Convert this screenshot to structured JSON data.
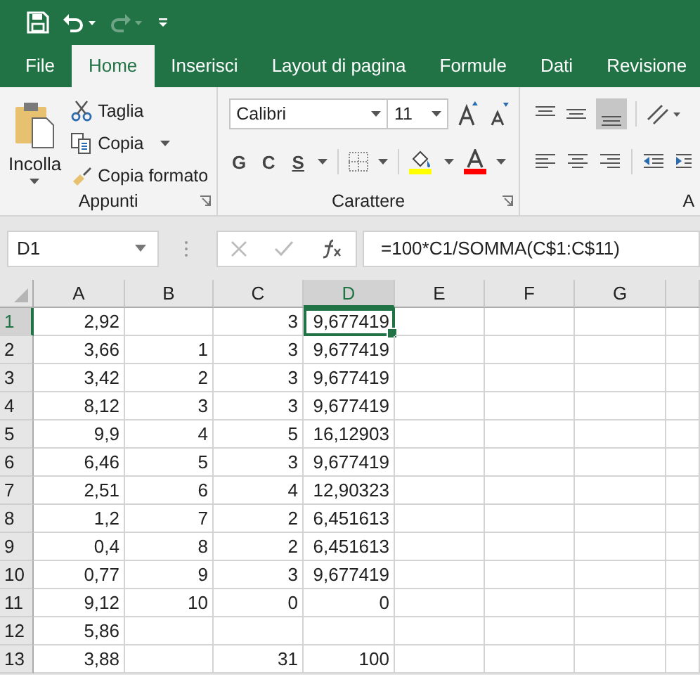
{
  "quick_access": {
    "redo_disabled": true
  },
  "tabs": [
    {
      "label": "File",
      "selected": false
    },
    {
      "label": "Home",
      "selected": true
    },
    {
      "label": "Inserisci",
      "selected": false
    },
    {
      "label": "Layout di pagina",
      "selected": false
    },
    {
      "label": "Formule",
      "selected": false
    },
    {
      "label": "Dati",
      "selected": false
    },
    {
      "label": "Revisione",
      "selected": false
    }
  ],
  "ribbon": {
    "clipboard": {
      "paste": "Incolla",
      "cut": "Taglia",
      "copy": "Copia",
      "format_painter": "Copia formato",
      "label": "Appunti"
    },
    "font": {
      "font_name": "Calibri",
      "font_size": "11",
      "bold": "G",
      "italic": "C",
      "underline": "S",
      "label": "Carattere"
    },
    "alignment": {
      "label": "A"
    }
  },
  "formula_bar": {
    "name_box": "D1",
    "formula": "=100*C1/SOMMA(C$1:C$11)"
  },
  "sheet": {
    "columns": [
      {
        "label": "A",
        "selected": false
      },
      {
        "label": "B",
        "selected": false
      },
      {
        "label": "C",
        "selected": false
      },
      {
        "label": "D",
        "selected": true
      },
      {
        "label": "E",
        "selected": false
      },
      {
        "label": "F",
        "selected": false
      },
      {
        "label": "G",
        "selected": false
      }
    ],
    "rows": [
      {
        "label": "1",
        "selected": true,
        "cells": [
          "2,92",
          null,
          "3",
          "9,677419"
        ]
      },
      {
        "label": "2",
        "selected": false,
        "cells": [
          "3,66",
          "1",
          "3",
          "9,677419"
        ]
      },
      {
        "label": "3",
        "selected": false,
        "cells": [
          "3,42",
          "2",
          "3",
          "9,677419"
        ]
      },
      {
        "label": "4",
        "selected": false,
        "cells": [
          "8,12",
          "3",
          "3",
          "9,677419"
        ]
      },
      {
        "label": "5",
        "selected": false,
        "cells": [
          "9,9",
          "4",
          "5",
          "16,12903"
        ]
      },
      {
        "label": "6",
        "selected": false,
        "cells": [
          "6,46",
          "5",
          "3",
          "9,677419"
        ]
      },
      {
        "label": "7",
        "selected": false,
        "cells": [
          "2,51",
          "6",
          "4",
          "12,90323"
        ]
      },
      {
        "label": "8",
        "selected": false,
        "cells": [
          "1,2",
          "7",
          "2",
          "6,451613"
        ]
      },
      {
        "label": "9",
        "selected": false,
        "cells": [
          "0,4",
          "8",
          "2",
          "6,451613"
        ]
      },
      {
        "label": "10",
        "selected": false,
        "cells": [
          "0,77",
          "9",
          "3",
          "9,677419"
        ]
      },
      {
        "label": "11",
        "selected": false,
        "cells": [
          "9,12",
          "10",
          "0",
          "0"
        ]
      },
      {
        "label": "12",
        "selected": false,
        "cells": [
          "5,86",
          null,
          null,
          null
        ]
      },
      {
        "label": "13",
        "selected": false,
        "cells": [
          "3,88",
          null,
          "31",
          "100"
        ]
      }
    ]
  }
}
